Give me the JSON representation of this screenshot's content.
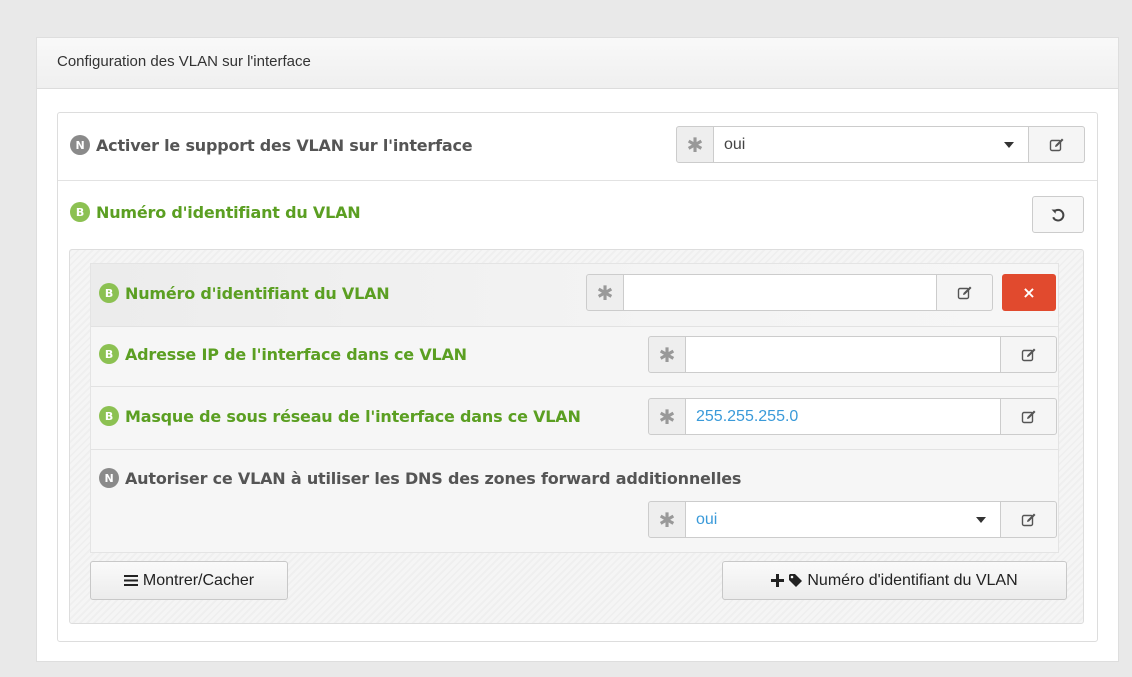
{
  "panel": {
    "title": "Configuration des VLAN sur l'interface"
  },
  "vlan_support": {
    "badge": "N",
    "label": "Activer le support des VLAN sur l'interface",
    "required_marker": "✱",
    "value": "oui"
  },
  "vlan_group": {
    "badge": "B",
    "label": "Numéro d'identifiant du VLAN"
  },
  "vlan_fields": {
    "vlan_id": {
      "badge": "B",
      "label": "Numéro d'identifiant du VLAN",
      "required_marker": "✱",
      "value": "",
      "delete_label": "×"
    },
    "ip_address": {
      "badge": "B",
      "label": "Adresse IP de l'interface dans ce VLAN",
      "required_marker": "✱",
      "value": ""
    },
    "netmask": {
      "badge": "B",
      "label": "Masque de sous réseau de l'interface dans ce VLAN",
      "required_marker": "✱",
      "value": "255.255.255.0"
    },
    "dns_forward": {
      "badge": "N",
      "label": "Autoriser ce VLAN à utiliser les DNS des zones forward additionnelles",
      "required_marker": "✱",
      "value": "oui"
    }
  },
  "actions": {
    "toggle_label": "Montrer/Cacher",
    "add_label": "Numéro d'identifiant du VLAN"
  },
  "colors": {
    "green_label": "#5b9f22",
    "grey_badge": "#8a8a8a",
    "green_badge": "#8cc152",
    "delete_button": "#e14a2e",
    "value_blue": "#3a9ad9"
  }
}
